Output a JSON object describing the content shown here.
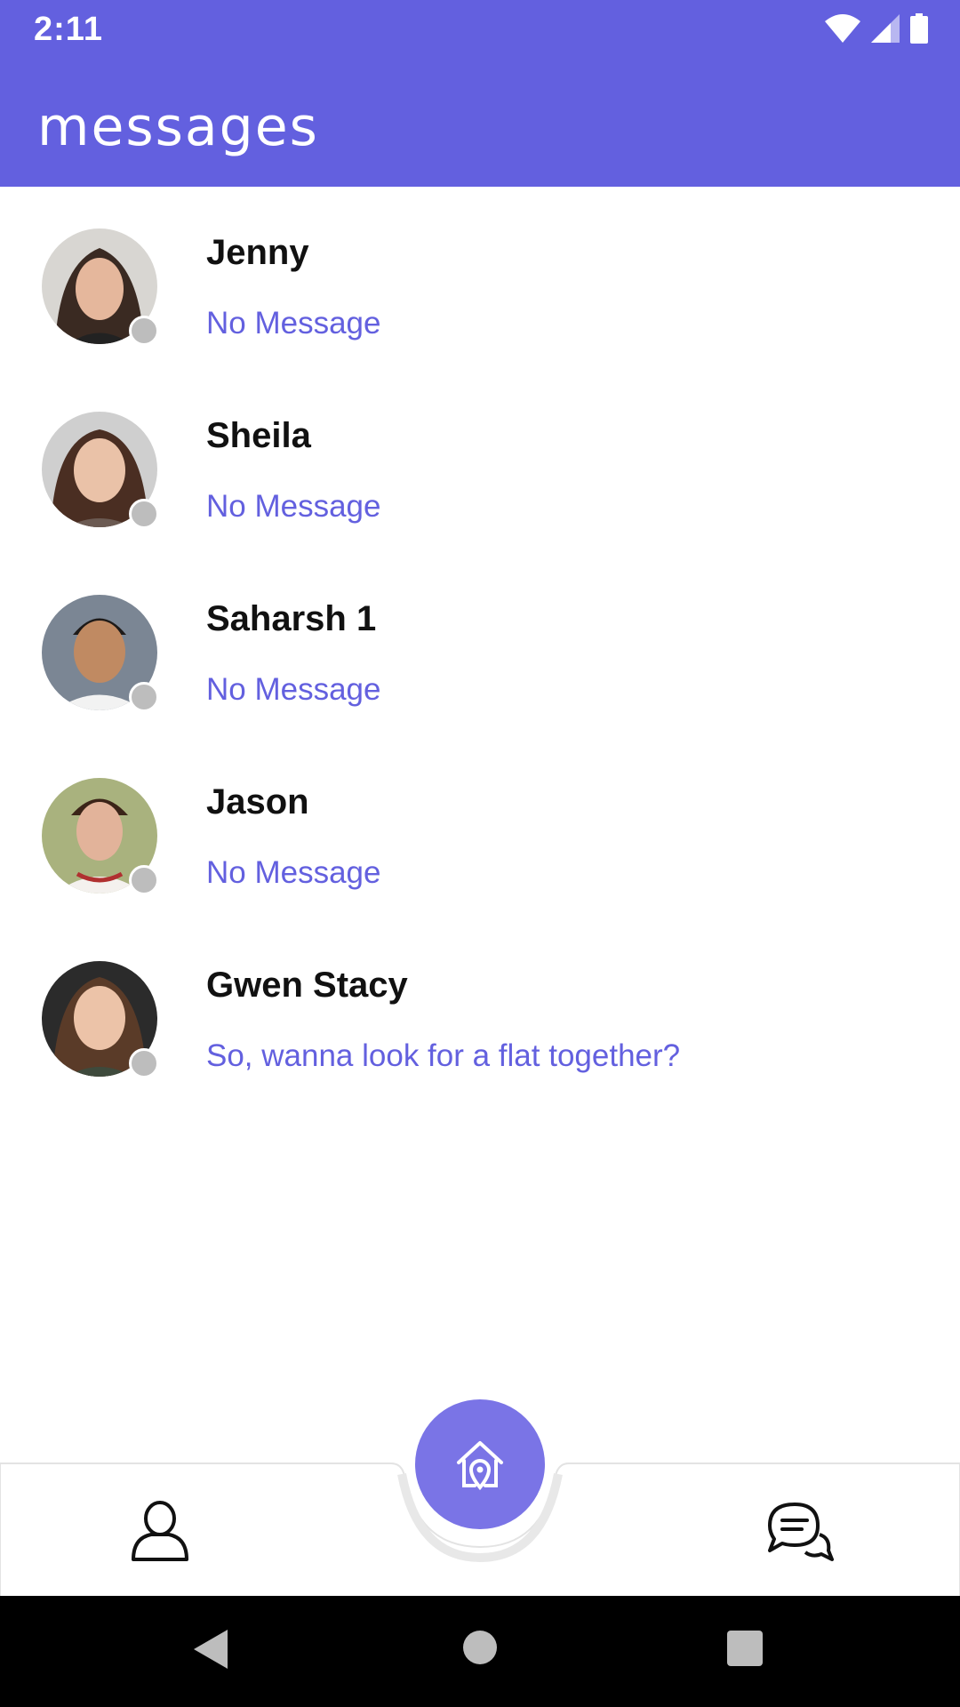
{
  "status_bar": {
    "time": "2:11",
    "icons": [
      "wifi-icon",
      "signal-icon",
      "battery-icon"
    ]
  },
  "header": {
    "title": "messages"
  },
  "colors": {
    "primary": "#6360DF",
    "fab": "#7A74E6",
    "presence": "#bdbdbd"
  },
  "conversations": [
    {
      "name": "Jenny",
      "preview": "No Message"
    },
    {
      "name": "Sheila",
      "preview": "No Message"
    },
    {
      "name": "Saharsh 1",
      "preview": "No Message"
    },
    {
      "name": "Jason",
      "preview": "No Message"
    },
    {
      "name": "Gwen Stacy",
      "preview": "So, wanna look for a flat together?"
    }
  ],
  "bottom_nav": {
    "items": [
      "profile-icon",
      "home-location-icon",
      "chat-bubbles-icon"
    ]
  }
}
